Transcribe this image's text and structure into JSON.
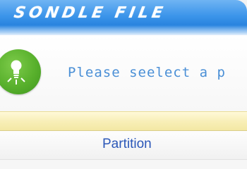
{
  "window": {
    "title": "SONDLE FILE",
    "accent_color": "#3c95ea"
  },
  "info": {
    "icon": "lightbulb-icon",
    "icon_color": "#58b02c",
    "message": "Please seelect a p"
  },
  "table": {
    "columns": [
      {
        "label": "Partition"
      }
    ]
  }
}
